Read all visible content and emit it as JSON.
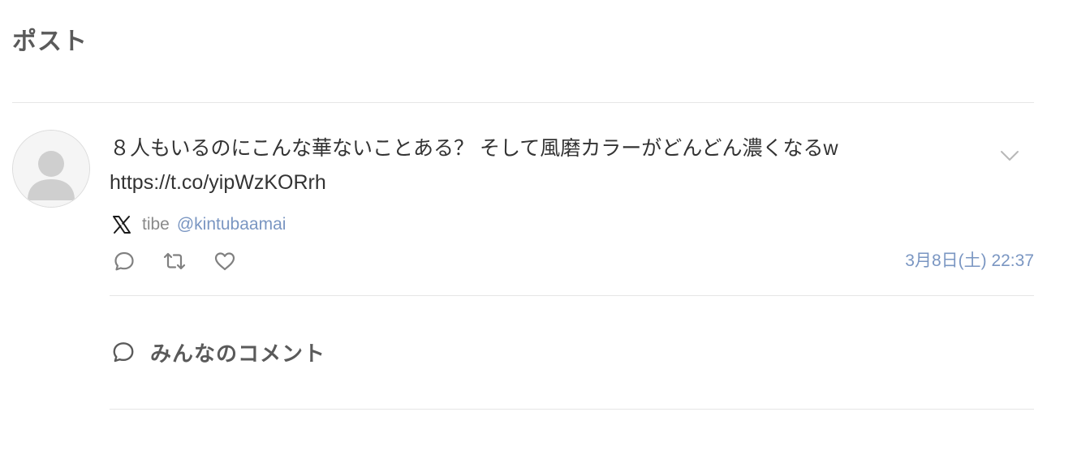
{
  "page": {
    "title": "ポスト"
  },
  "post": {
    "avatar_icon": "default-user-avatar-icon",
    "text_line1": "８人もいるのにこんな華ないことある？ そして風磨カラーがどんどん濃くなるw",
    "link": "https://t.co/yipWzKORrh",
    "menu_icon": "chevron-down-icon",
    "source_icon": "x-logo-icon",
    "author_name": "tibe",
    "author_handle": "@kintubaamai",
    "timestamp": "3月8日(土) 22:37",
    "actions": [
      {
        "name": "reply",
        "icon": "speech-bubble-icon"
      },
      {
        "name": "repost",
        "icon": "repost-arrows-icon"
      },
      {
        "name": "like",
        "icon": "heart-icon"
      }
    ]
  },
  "comments": {
    "icon": "speech-bubble-icon",
    "title": "みんなのコメント"
  },
  "colors": {
    "title_text": "#5a5a5a",
    "body_text": "#333333",
    "muted_text": "#8a8a8a",
    "accent_link": "#7a96c2",
    "icon_stroke": "#808080",
    "divider": "#e6e6e6"
  }
}
